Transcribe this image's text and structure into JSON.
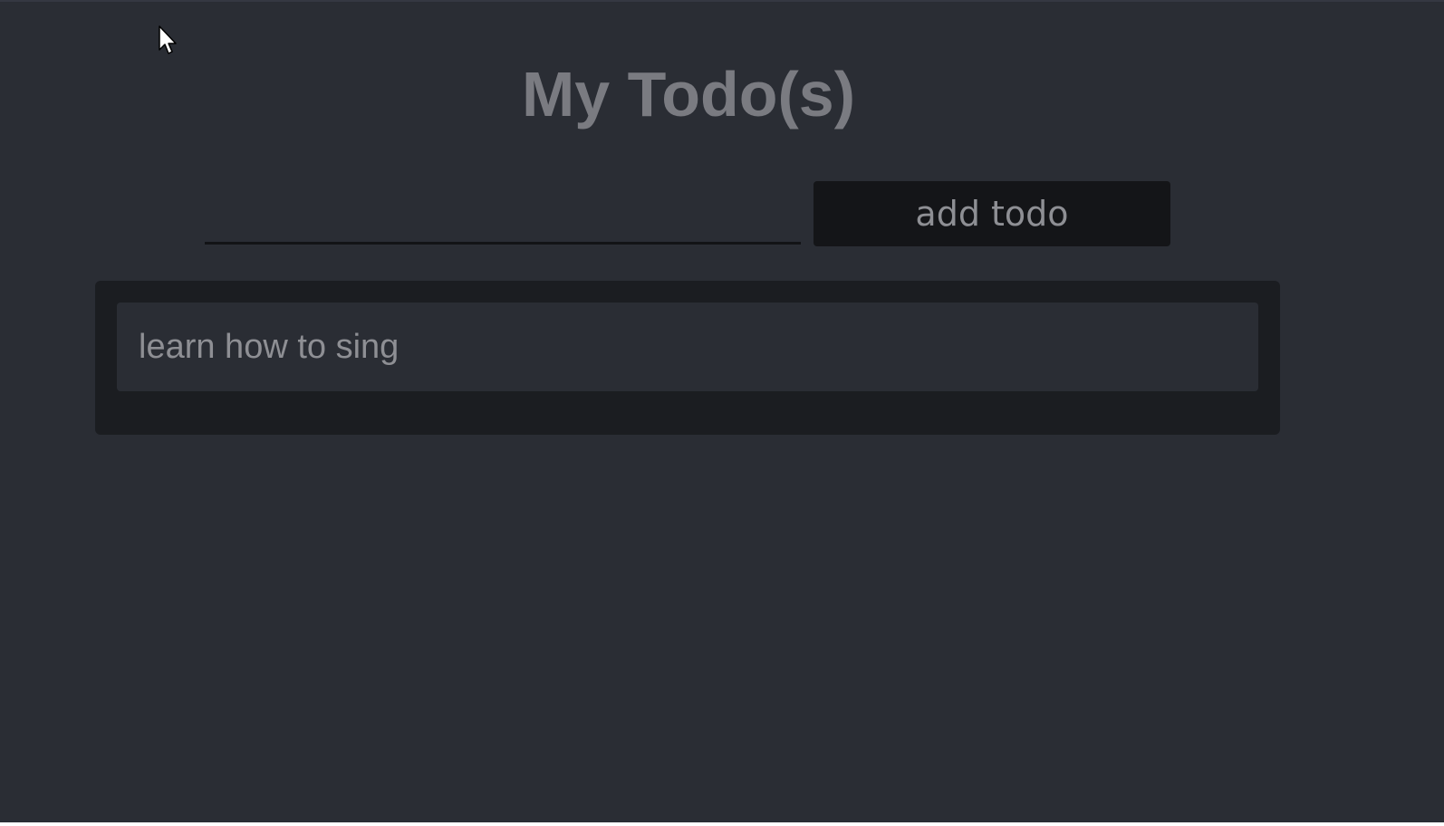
{
  "header": {
    "title": "My Todo(s)"
  },
  "form": {
    "input_value": "",
    "input_placeholder": "",
    "add_button_label": "add todo"
  },
  "todos": [
    {
      "text": "learn how to sing"
    }
  ],
  "colors": {
    "background": "#2a2d34",
    "panel": "#1b1d21",
    "button": "#141518",
    "text": "#8e8f94",
    "title": "#7a7b81"
  },
  "icons": {
    "cursor": "mouse-pointer-icon"
  }
}
